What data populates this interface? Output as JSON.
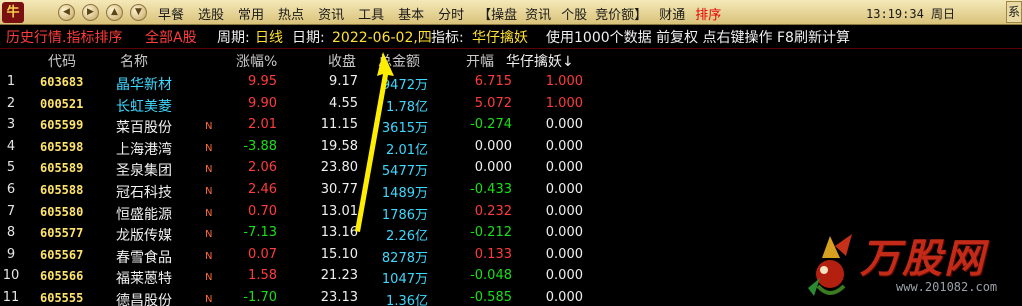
{
  "menubar": {
    "logo": "牛",
    "nav": [
      "◀",
      "▶",
      "▲",
      "▼"
    ],
    "items": [
      "早餐",
      "选股",
      "常用",
      "热点",
      "资讯",
      "工具",
      "基本",
      "分时",
      "【操盘",
      "资讯",
      "个股",
      "竞价额】",
      "财通",
      "排序"
    ],
    "clock": "13:19:34 周日",
    "edge": "系"
  },
  "infobar": {
    "title": "历史行情.指标排序",
    "board": "全部A股",
    "period_label": "周期:",
    "period": "日线",
    "date_label": "日期:",
    "date": "2022-06-02,四",
    "indicator_label": "指标:",
    "indicator": "华仔擒妖",
    "note": "使用1000个数据 前复权 点右键操作 F8刷新计算"
  },
  "columns": {
    "code": "代码",
    "name": "名称",
    "change": "涨幅%",
    "close": "收盘",
    "amount": "总金额",
    "open": "开幅",
    "indicator": "华仔擒妖↓"
  },
  "rows": [
    {
      "idx": "1",
      "code": "603683",
      "name": "晶华新材",
      "name_style": "cyan",
      "flag": "",
      "change": "9.95",
      "close": "9.17",
      "amount": "9472万",
      "open": "6.715",
      "ind": "1.000",
      "dir": "up",
      "open_dir": "up",
      "ind_dir": "up"
    },
    {
      "idx": "2",
      "code": "000521",
      "name": "长虹美菱",
      "name_style": "cyan",
      "flag": "",
      "change": "9.90",
      "close": "4.55",
      "amount": "1.78亿",
      "open": "5.072",
      "ind": "1.000",
      "dir": "up",
      "open_dir": "up",
      "ind_dir": "up"
    },
    {
      "idx": "3",
      "code": "605599",
      "name": "菜百股份",
      "name_style": "white",
      "flag": "N",
      "change": "2.01",
      "close": "11.15",
      "amount": "3615万",
      "open": "-0.274",
      "ind": "0.000",
      "dir": "up",
      "open_dir": "down",
      "ind_dir": "flat"
    },
    {
      "idx": "4",
      "code": "605598",
      "name": "上海港湾",
      "name_style": "white",
      "flag": "N",
      "change": "-3.88",
      "close": "19.58",
      "amount": "2.01亿",
      "open": "0.000",
      "ind": "0.000",
      "dir": "down",
      "open_dir": "flat",
      "ind_dir": "flat"
    },
    {
      "idx": "5",
      "code": "605589",
      "name": "圣泉集团",
      "name_style": "white",
      "flag": "N",
      "change": "2.06",
      "close": "23.80",
      "amount": "5477万",
      "open": "0.000",
      "ind": "0.000",
      "dir": "up",
      "open_dir": "flat",
      "ind_dir": "flat"
    },
    {
      "idx": "6",
      "code": "605588",
      "name": "冠石科技",
      "name_style": "white",
      "flag": "N",
      "change": "2.46",
      "close": "30.77",
      "amount": "1489万",
      "open": "-0.433",
      "ind": "0.000",
      "dir": "up",
      "open_dir": "down",
      "ind_dir": "flat"
    },
    {
      "idx": "7",
      "code": "605580",
      "name": "恒盛能源",
      "name_style": "white",
      "flag": "N",
      "change": "0.70",
      "close": "13.01",
      "amount": "1786万",
      "open": "0.232",
      "ind": "0.000",
      "dir": "up",
      "open_dir": "up",
      "ind_dir": "flat"
    },
    {
      "idx": "8",
      "code": "605577",
      "name": "龙版传媒",
      "name_style": "white",
      "flag": "N",
      "change": "-7.13",
      "close": "13.16",
      "amount": "2.26亿",
      "open": "-0.212",
      "ind": "0.000",
      "dir": "down",
      "open_dir": "down",
      "ind_dir": "flat"
    },
    {
      "idx": "9",
      "code": "605567",
      "name": "春雪食品",
      "name_style": "white",
      "flag": "N",
      "change": "0.07",
      "close": "15.10",
      "amount": "8278万",
      "open": "0.133",
      "ind": "0.000",
      "dir": "up",
      "open_dir": "up",
      "ind_dir": "flat"
    },
    {
      "idx": "10",
      "code": "605566",
      "name": "福莱蒽特",
      "name_style": "white",
      "flag": "N",
      "change": "1.58",
      "close": "21.23",
      "amount": "1047万",
      "open": "-0.048",
      "ind": "0.000",
      "dir": "up",
      "open_dir": "down",
      "ind_dir": "flat"
    },
    {
      "idx": "11",
      "code": "605555",
      "name": "德昌股份",
      "name_style": "white",
      "flag": "N",
      "change": "-1.70",
      "close": "23.13",
      "amount": "1.36亿",
      "open": "-0.585",
      "ind": "0.000",
      "dir": "down",
      "open_dir": "down",
      "ind_dir": "flat"
    }
  ],
  "watermark": {
    "title": "万股网",
    "url": "www.201082.com"
  },
  "colors": {
    "up": "#ff3c3c",
    "down": "#18e018",
    "code": "#ffe46a",
    "amount": "#3fd8ff",
    "arrow": "#ffee00"
  }
}
